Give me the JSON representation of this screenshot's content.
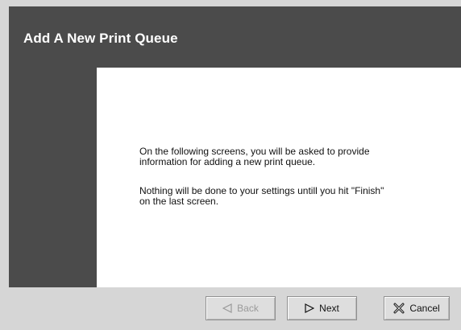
{
  "window": {
    "title": "Add A New Print Queue"
  },
  "content": {
    "paragraph1": "On the following screens, you will be asked to provide\ninformation for adding a new print queue.",
    "paragraph2": "Nothing will be done to your settings untill you hit \"Finish\"\non the last screen."
  },
  "buttons": {
    "back_label": "Back",
    "back_icon": "left-triangle-icon",
    "back_disabled": true,
    "next_label": "Next",
    "next_icon": "right-triangle-icon",
    "cancel_label": "Cancel",
    "cancel_icon": "cancel-x-icon"
  },
  "colors": {
    "sidebar": "#4b4b4b",
    "content_bg": "#ffffff",
    "button_bar": "#d6d6d6"
  }
}
